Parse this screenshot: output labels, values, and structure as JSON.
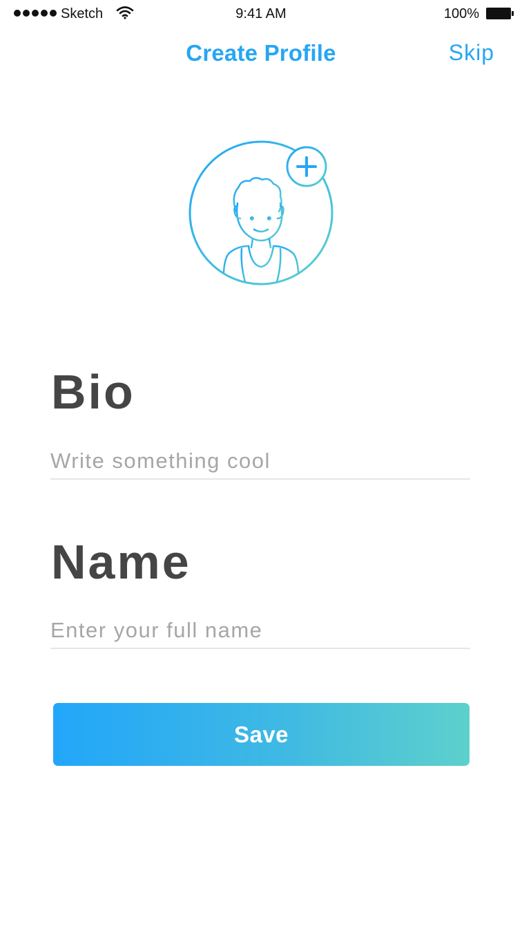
{
  "status_bar": {
    "carrier": "Sketch",
    "time": "9:41 AM",
    "battery": "100%",
    "signal_icon": "signal-dots-icon",
    "wifi_icon": "wifi-icon",
    "battery_icon": "battery-icon"
  },
  "nav": {
    "title": "Create Profile",
    "skip_label": "Skip"
  },
  "avatar": {
    "icon": "user-avatar-icon",
    "add_icon": "plus-icon"
  },
  "form": {
    "bio": {
      "label": "Bio",
      "placeholder": "Write something cool",
      "value": ""
    },
    "name": {
      "label": "Name",
      "placeholder": "Enter your full name",
      "value": ""
    },
    "save_label": "Save"
  },
  "colors": {
    "accent": "#27a6f2",
    "gradient_start": "#22a6f9",
    "gradient_end": "#5dd0cc",
    "label_text": "#454545",
    "placeholder_text": "#a6a6a6"
  }
}
